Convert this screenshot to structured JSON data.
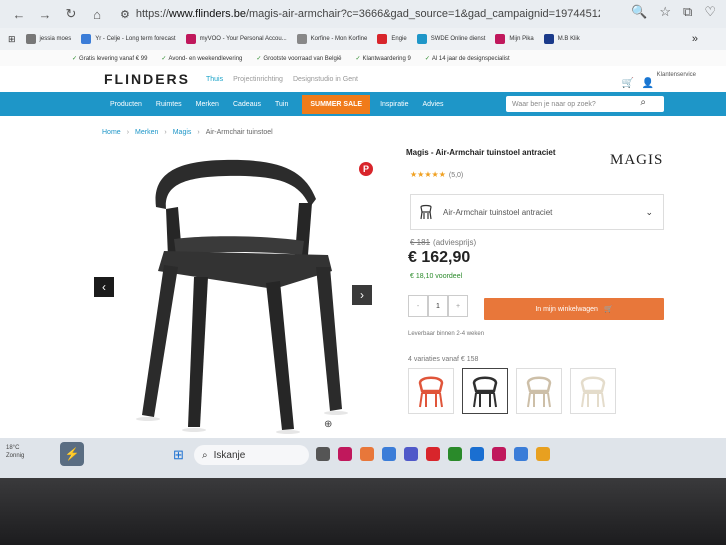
{
  "browser": {
    "url_prefix": "https://",
    "url_host": "www.flinders.be",
    "url_path": "/magis-air-armchair?c=3666&gad_source=1&gad_campaignid=1974451239..."
  },
  "bookmarks": [
    {
      "label": "jessia moes",
      "color": "#777777"
    },
    {
      "label": "Yr - Celje - Long term forecast",
      "color": "#3b7dd8"
    },
    {
      "label": "myVOO - Your Personal Accou...",
      "color": "#c0185c"
    },
    {
      "label": "Korfine - Mon Korfine",
      "color": "#888888"
    },
    {
      "label": "Engie",
      "color": "#d8252b"
    },
    {
      "label": "SWDE Online dienst",
      "color": "#1e96c8"
    },
    {
      "label": "Mijn Pika",
      "color": "#c0185c"
    },
    {
      "label": "M.B Klik",
      "color": "#1a3a8a"
    }
  ],
  "usp": [
    "Gratis levering vanaf € 99",
    "Avond- en weekendlevering",
    "Grootste voorraad van België",
    "Klantwaardering 9",
    "Al 14 jaar de designspecialist"
  ],
  "header": {
    "logo": "FLINDERS",
    "links": [
      "Thuis",
      "Projectinrichting",
      "Designstudio in Gent"
    ],
    "klantenservice": "Klantenservice"
  },
  "mainnav": {
    "items": [
      "Producten",
      "Ruimtes",
      "Merken",
      "Cadeaus",
      "Tuin"
    ],
    "summer": "SUMMER SALE",
    "extra": [
      "Inspiratie",
      "Advies"
    ],
    "search_placeholder": "Waar ben je naar op zoek?"
  },
  "breadcrumb": [
    "Home",
    "Merken",
    "Magis",
    "Air-Armchair tuinstoel"
  ],
  "product": {
    "title": "Magis - Air-Armchair tuinstoel antraciet",
    "brand": "MAGIS",
    "stars": "★★★★★",
    "rating_count": "(5,0)",
    "variant": "Air-Armchair tuinstoel antraciet",
    "old_price": "€ 181",
    "old_label": "(adviesprijs)",
    "price": "€ 162,90",
    "saving": "€ 18,10 voordeel",
    "qty": "1",
    "qty_minus": "-",
    "qty_plus": "+",
    "cart_button": "In mijn winkelwagen",
    "delivery": "Leverbaar binnen 2-4 weken",
    "variations": "4 variaties vanaf € 158",
    "swatch_colors": [
      "#e0553a",
      "#2f2f2f",
      "#cdbfa8",
      "#e4dccb"
    ]
  },
  "taskbar": {
    "temp": "18°C",
    "weather": "Zonnig",
    "search": "Iskanje",
    "app_colors": [
      "#555555",
      "#c0185c",
      "#e8773a",
      "#3b7dd8",
      "#5059c9",
      "#d8252b",
      "#2a8a2a",
      "#1a6fd1",
      "#c0185c",
      "#3b7dd8",
      "#e8a020"
    ]
  }
}
